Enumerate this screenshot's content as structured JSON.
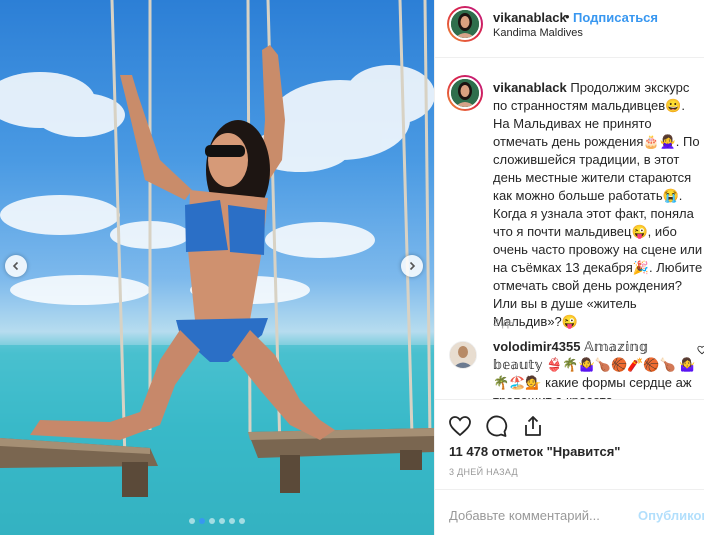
{
  "post": {
    "username": "vikanablack",
    "separator": "•",
    "follow_label": "Подписаться",
    "location": "Kandima Maldives"
  },
  "photo": {
    "slide_count": 6,
    "active_slide": 2,
    "sky_color": "#3d8fdc",
    "water_color": "#37b4c4",
    "bikini_color": "#2b6fc6"
  },
  "caption": {
    "username": "vikanablack",
    "text": "Продолжим экскурс по странностям мальдивцев😀. На Мальдивах не принято отмечать день рождения🎂🙅‍♀️. По сложившейся традиции, в этот день местные жители стараются как можно больше работать😭. Когда я узнала этот факт, поняла что я почти мальдивец😜, ибо очень часто провожу на сцене или на съёмках 13 декабря🎉. Любите отмечать свой день рождения? Или вы в душе «житель Мальдив»?😜",
    "time": "3 дн."
  },
  "comment": {
    "username": "volodimir4355",
    "text": "𝔸𝕞𝕒𝕫𝕚𝕟𝕘 𝕓𝕖𝕒𝕦𝕥𝕪 👙🌴🤷‍♀️🍗🏀🧨🏀🍗 🤷‍♀️🌴🏖️💁 какие формы сердце аж трепещит а красота"
  },
  "actions": {
    "like_icon": "heart-icon",
    "comment_icon": "comment-bubble-icon",
    "share_icon": "share-icon",
    "likes_text": "11 478 отметок \"Нравится\"",
    "date": "3 ДНЕЙ НАЗАД"
  },
  "add_comment": {
    "placeholder": "Добавьте комментарий...",
    "publish_label": "Опубликовать"
  }
}
